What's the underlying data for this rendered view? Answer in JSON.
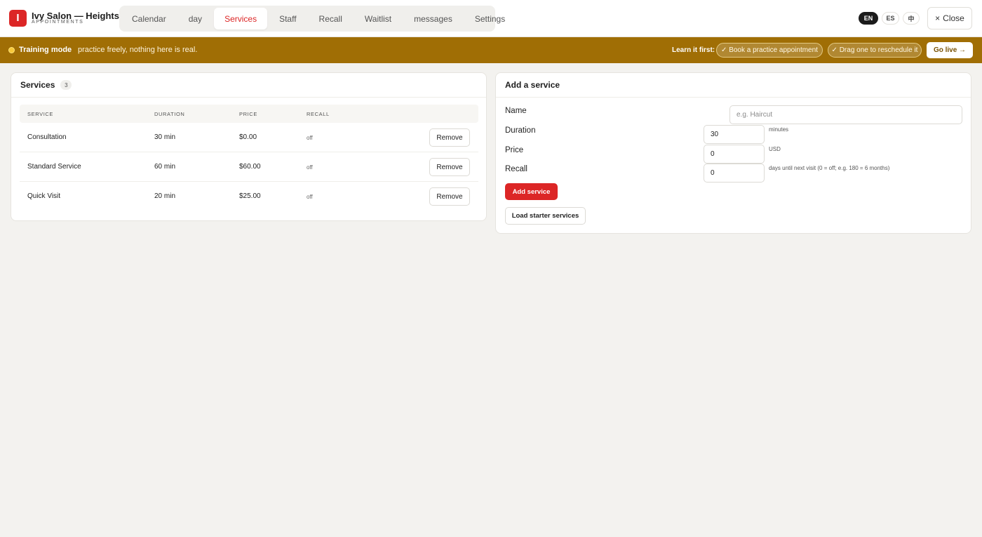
{
  "app": {
    "logo_letter": "I",
    "name": "Ivy Salon — Heights",
    "subtitle": "APPOINTMENTS"
  },
  "nav": {
    "tabs": [
      {
        "label": "Calendar",
        "active": false
      },
      {
        "label": "day",
        "active": false
      },
      {
        "label": "Services",
        "active": true
      },
      {
        "label": "Staff",
        "active": false
      },
      {
        "label": "Recall",
        "active": false
      },
      {
        "label": "Waitlist",
        "active": false
      },
      {
        "label": "messages",
        "active": false
      },
      {
        "label": "Settings",
        "active": false
      }
    ]
  },
  "languages": [
    {
      "label": "EN",
      "active": true
    },
    {
      "label": "ES",
      "active": false
    },
    {
      "label": "中",
      "active": false
    }
  ],
  "close": {
    "icon": "×",
    "label": "Close"
  },
  "banner": {
    "title": "Training mode",
    "message": "practice freely, nothing here is real.",
    "learn_label": "Learn it first:",
    "tasks": [
      "✓ Book a practice appointment",
      "✓ Drag one to reschedule it"
    ],
    "go_live": "Go live →"
  },
  "services_card": {
    "title": "Services",
    "count": "3",
    "columns": [
      "SERVICE",
      "DURATION",
      "PRICE",
      "RECALL"
    ],
    "rows": [
      {
        "service": "Consultation",
        "duration": "30 min",
        "price": "$0.00",
        "recall": "off",
        "action": "Remove"
      },
      {
        "service": "Standard Service",
        "duration": "60 min",
        "price": "$60.00",
        "recall": "off",
        "action": "Remove"
      },
      {
        "service": "Quick Visit",
        "duration": "20 min",
        "price": "$25.00",
        "recall": "off",
        "action": "Remove"
      }
    ]
  },
  "add_card": {
    "title": "Add a service",
    "name_label": "Name",
    "name_placeholder": "e.g. Haircut",
    "duration_label": "Duration",
    "duration_value": "30",
    "duration_hint": "minutes",
    "price_label": "Price",
    "price_value": "0",
    "price_hint": "USD",
    "recall_label": "Recall",
    "recall_value": "0",
    "recall_hint": "days until next visit (0 = off; e.g. 180 = 6 months)",
    "add_button": "Add service",
    "starter_button": "Load starter services"
  },
  "colors": {
    "accent": "#dc2626",
    "banner": "#a06e05",
    "background": "#f3f2ef"
  }
}
